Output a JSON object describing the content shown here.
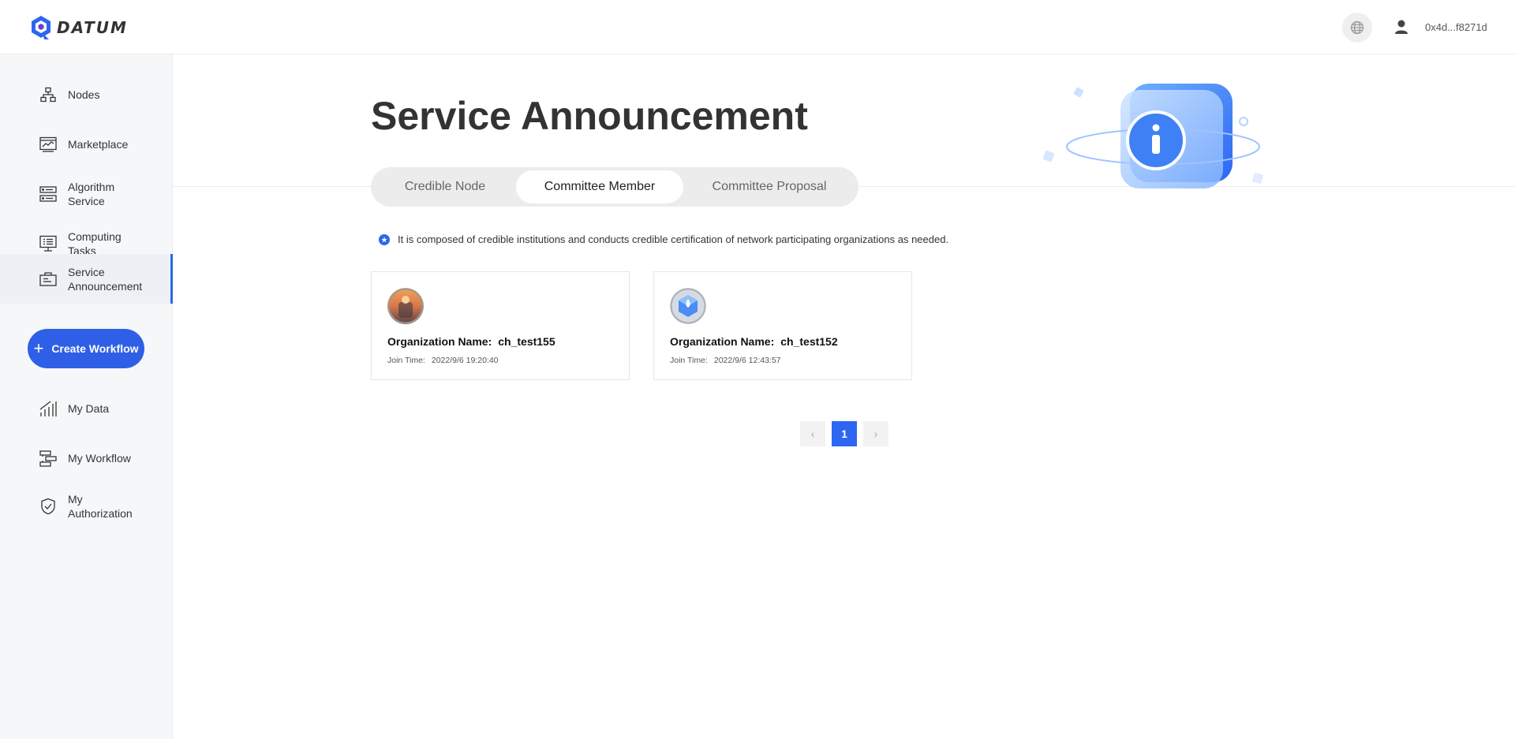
{
  "header": {
    "brand": "DATUM",
    "account": "0x4d...f8271d"
  },
  "sidebar": {
    "items": [
      {
        "label": "Nodes",
        "icon": "nodes-icon"
      },
      {
        "label": "Marketplace",
        "icon": "marketplace-icon"
      },
      {
        "label": "Algorithm Service",
        "icon": "algorithm-icon"
      },
      {
        "label": "Computing Tasks",
        "icon": "tasks-icon"
      },
      {
        "label": "Service Announcement",
        "icon": "announcement-icon",
        "active": true
      }
    ],
    "create_label": "Create Workflow",
    "items2": [
      {
        "label": "My Data",
        "icon": "chart-bars-icon"
      },
      {
        "label": "My Workflow",
        "icon": "workflow-icon"
      },
      {
        "label": "My Authorization",
        "icon": "shield-check-icon"
      }
    ]
  },
  "main": {
    "title": "Service Announcement",
    "tabs": [
      {
        "label": "Credible Node"
      },
      {
        "label": "Committee Member",
        "active": true
      },
      {
        "label": "Committee Proposal"
      }
    ],
    "info": "It is composed of credible institutions and conducts credible certification of network participating organizations as needed.",
    "cards": [
      {
        "org_label": "Organization Name:",
        "org_name": "ch_test155",
        "join_label": "Join Time:",
        "join_time": "2022/9/6 19:20:40"
      },
      {
        "org_label": "Organization Name:",
        "org_name": "ch_test152",
        "join_label": "Join Time:",
        "join_time": "2022/9/6 12:43:57"
      }
    ],
    "pagination": {
      "current": "1",
      "prev": "‹",
      "next": "›"
    }
  },
  "colors": {
    "accent": "#2d66f0",
    "button": "#2f5fe6"
  }
}
